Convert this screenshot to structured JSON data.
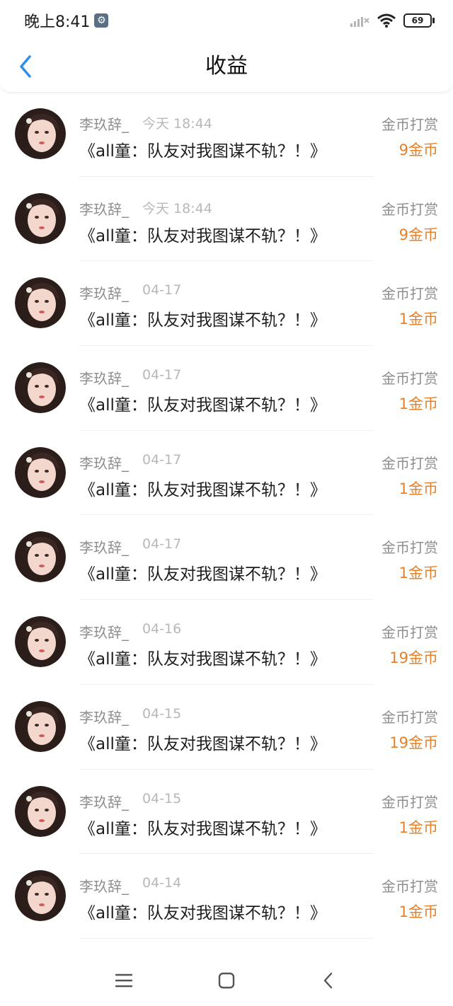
{
  "status": {
    "time": "晚上8:41",
    "battery": "69",
    "icons": [
      "gear-icon",
      "signal-icon",
      "wifi-icon",
      "battery-icon"
    ]
  },
  "header": {
    "title": "收益",
    "back_icon": "chevron-left-icon"
  },
  "colors": {
    "accent": "#2f8fe8",
    "amount": "#e6802b",
    "secondary_text": "#8e8e8e"
  },
  "records": [
    {
      "name": "李玖辞_",
      "date": "今天 18:44",
      "title": "《all童：队友对我图谋不轨？！》",
      "type": "金币打赏",
      "amount": "9金币"
    },
    {
      "name": "李玖辞_",
      "date": "今天 18:44",
      "title": "《all童：队友对我图谋不轨？！》",
      "type": "金币打赏",
      "amount": "9金币"
    },
    {
      "name": "李玖辞_",
      "date": "04-17",
      "title": "《all童：队友对我图谋不轨？！》",
      "type": "金币打赏",
      "amount": "1金币"
    },
    {
      "name": "李玖辞_",
      "date": "04-17",
      "title": "《all童：队友对我图谋不轨？！》",
      "type": "金币打赏",
      "amount": "1金币"
    },
    {
      "name": "李玖辞_",
      "date": "04-17",
      "title": "《all童：队友对我图谋不轨？！》",
      "type": "金币打赏",
      "amount": "1金币"
    },
    {
      "name": "李玖辞_",
      "date": "04-17",
      "title": "《all童：队友对我图谋不轨？！》",
      "type": "金币打赏",
      "amount": "1金币"
    },
    {
      "name": "李玖辞_",
      "date": "04-16",
      "title": "《all童：队友对我图谋不轨？！》",
      "type": "金币打赏",
      "amount": "19金币"
    },
    {
      "name": "李玖辞_",
      "date": "04-15",
      "title": "《all童：队友对我图谋不轨？！》",
      "type": "金币打赏",
      "amount": "19金币"
    },
    {
      "name": "李玖辞_",
      "date": "04-15",
      "title": "《all童：队友对我图谋不轨？！》",
      "type": "金币打赏",
      "amount": "1金币"
    },
    {
      "name": "李玖辞_",
      "date": "04-14",
      "title": "《all童：队友对我图谋不轨？！》",
      "type": "金币打赏",
      "amount": "1金币"
    }
  ],
  "navbar": {
    "icons": [
      "menu-icon",
      "home-icon",
      "back-icon"
    ]
  }
}
